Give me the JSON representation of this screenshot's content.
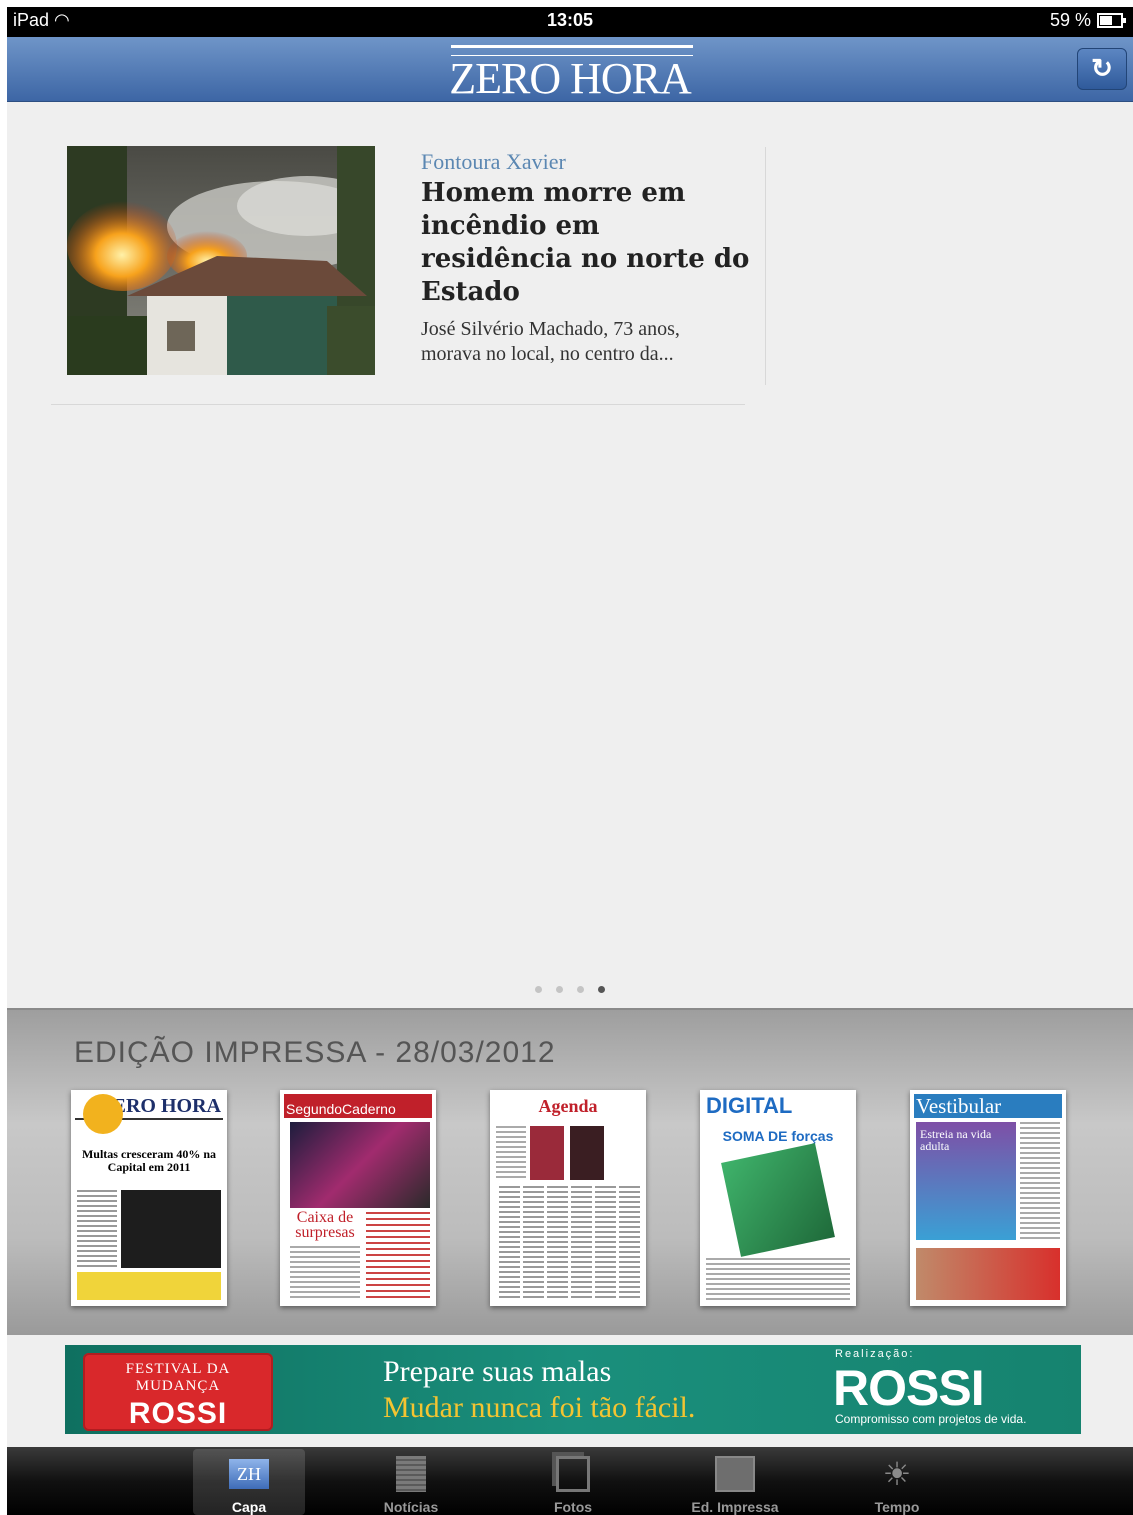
{
  "status": {
    "device": "iPad",
    "time": "13:05",
    "battery": "59 %"
  },
  "nav": {
    "logo": "ZERO HORA",
    "refresh_icon": "refresh-icon"
  },
  "article": {
    "kicker": "Fontoura Xavier",
    "headline": "Homem morre em incêndio em residência no norte do Estado",
    "summary": "José Silvério Machado, 73 anos, morava no local, no centro da..."
  },
  "pager": {
    "count": 4,
    "active": 4
  },
  "edition": {
    "title": "EDIÇÃO IMPRESSA - 28/03/2012",
    "covers": [
      {
        "masthead": "ZERO HORA",
        "headline": "Multas cresceram 40% na Capital em 2011"
      },
      {
        "masthead": "SegundoCaderno",
        "headline": "Caixa de surpresas"
      },
      {
        "masthead": "Agenda",
        "headline": ""
      },
      {
        "masthead": "DIGITAL",
        "headline": "SOMA DE forças"
      },
      {
        "masthead": "Vestibular",
        "headline": "Estreia na vida adulta"
      }
    ]
  },
  "ad": {
    "badge_line1": "FESTIVAL DA MUDANÇA",
    "badge_line2": "ROSSI",
    "line1": "Prepare suas malas",
    "line2": "Mudar nunca foi tão fácil.",
    "realizacao": "Realização:",
    "brand": "ROSSI",
    "tagline": "Compromisso com projetos de vida."
  },
  "tabs": [
    {
      "label": "Capa",
      "icon": "zh-logo-icon",
      "active": true
    },
    {
      "label": "Notícias",
      "icon": "newspaper-icon",
      "active": false
    },
    {
      "label": "Fotos",
      "icon": "photos-icon",
      "active": false
    },
    {
      "label": "Ed. Impressa",
      "icon": "print-edition-icon",
      "active": false
    },
    {
      "label": "Tempo",
      "icon": "weather-icon",
      "active": false
    }
  ],
  "colors": {
    "nav": "#3d66a5",
    "kicker": "#5b87b2",
    "ad_bg": "#1a8f7c",
    "ad_accent": "#f4c431"
  }
}
